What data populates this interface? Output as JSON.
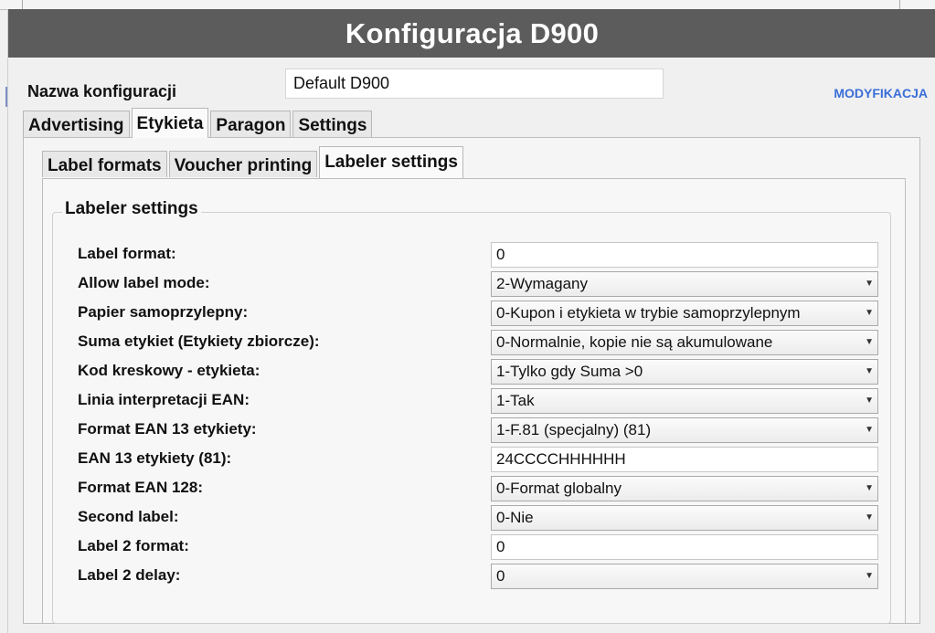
{
  "window": {
    "title": "Konfiguracja D900"
  },
  "config": {
    "name_label": "Nazwa konfiguracji",
    "name_value": "Default D900",
    "modify_link": "MODYFIKACJA"
  },
  "tabs": [
    {
      "label": "Advertising"
    },
    {
      "label": "Etykieta",
      "active": true
    },
    {
      "label": "Paragon"
    },
    {
      "label": "Settings"
    }
  ],
  "subtabs": [
    {
      "label": "Label formats"
    },
    {
      "label": "Voucher printing"
    },
    {
      "label": "Labeler settings",
      "active": true
    }
  ],
  "section": {
    "legend": "Labeler settings"
  },
  "rows": [
    {
      "label": "Label format:",
      "type": "input",
      "value": "0"
    },
    {
      "label": "Allow label mode:",
      "type": "select",
      "value": "2-Wymagany"
    },
    {
      "label": "Papier samoprzylepny:",
      "type": "select",
      "value": "0-Kupon i etykieta w trybie samoprzylepnym"
    },
    {
      "label": "Suma etykiet (Etykiety zbiorcze):",
      "type": "select",
      "value": "0-Normalnie, kopie nie są akumulowane"
    },
    {
      "label": "Kod kreskowy - etykieta:",
      "type": "select",
      "value": "1-Tylko gdy Suma >0"
    },
    {
      "label": "Linia interpretacji EAN:",
      "type": "select",
      "value": "1-Tak"
    },
    {
      "label": "Format EAN 13 etykiety:",
      "type": "select",
      "value": "1-F.81 (specjalny) (81)"
    },
    {
      "label": "EAN 13 etykiety (81):",
      "type": "input",
      "value": "24CCCCHHHHHH"
    },
    {
      "label": "Format EAN 128:",
      "type": "select",
      "value": "0-Format globalny"
    },
    {
      "label": "Second label:",
      "type": "select",
      "value": "0-Nie"
    },
    {
      "label": "Label 2 format:",
      "type": "input",
      "value": "0"
    },
    {
      "label": "Label 2 delay:",
      "type": "select",
      "value": "0"
    }
  ]
}
